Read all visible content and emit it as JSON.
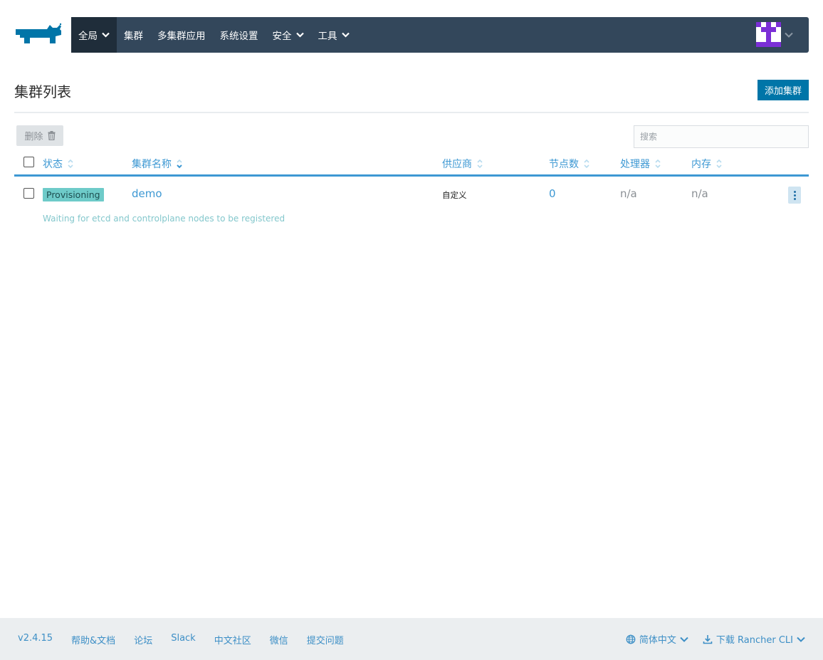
{
  "nav": {
    "items": [
      {
        "label": "全局",
        "has_dropdown": true,
        "active": true
      },
      {
        "label": "集群",
        "has_dropdown": false
      },
      {
        "label": "多集群应用",
        "has_dropdown": false
      },
      {
        "label": "系统设置",
        "has_dropdown": false
      },
      {
        "label": "安全",
        "has_dropdown": true
      },
      {
        "label": "工具",
        "has_dropdown": true
      }
    ]
  },
  "page": {
    "title": "集群列表",
    "add_button": "添加集群",
    "delete_button": "删除",
    "search_placeholder": "搜索"
  },
  "table": {
    "columns": [
      "状态",
      "集群名称",
      "供应商",
      "节点数",
      "处理器",
      "内存"
    ],
    "rows": [
      {
        "state": "Provisioning",
        "name": "demo",
        "provider": "自定义",
        "nodes": "0",
        "cpu": "n/a",
        "memory": "n/a",
        "message": "Waiting for etcd and controlplane nodes to be registered"
      }
    ]
  },
  "footer": {
    "version": "v2.4.15",
    "links": [
      "帮助&文档",
      "论坛",
      "Slack",
      "中文社区",
      "微信",
      "提交问题"
    ],
    "language": "简体中文",
    "download": "下载 Rancher CLI"
  },
  "colors": {
    "nav_bg": "#33475b",
    "nav_active": "#1f2d3a",
    "primary": "#0075a8",
    "link": "#3d98d3",
    "badge": "#6ecbc9"
  }
}
